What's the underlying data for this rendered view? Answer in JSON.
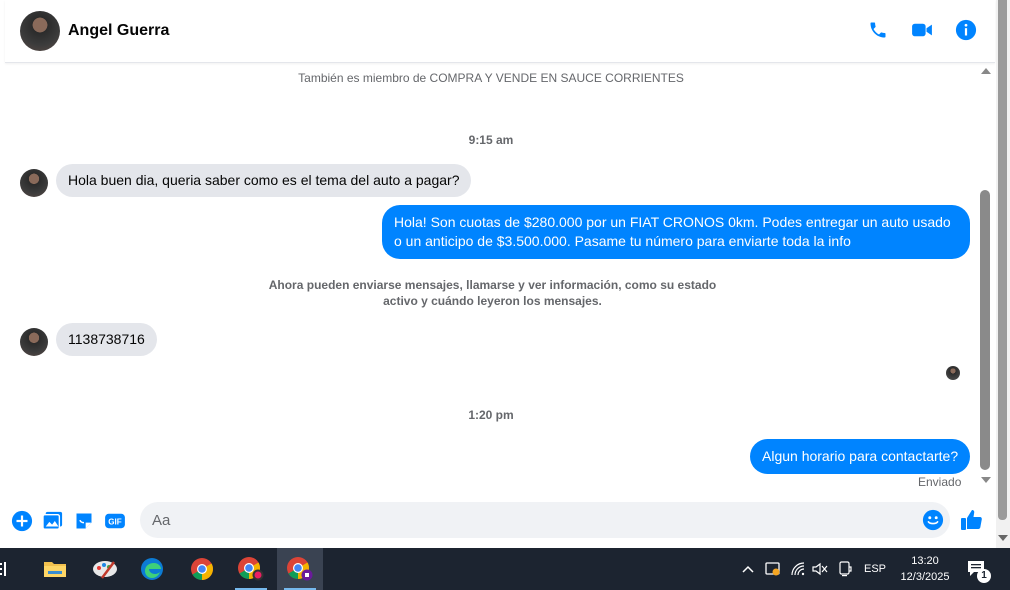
{
  "header": {
    "contact_name": "Angel Guerra"
  },
  "messages": {
    "group_info": "También es miembro de COMPRA Y VENDE EN SAUCE CORRIENTES",
    "time_1": "9:15 am",
    "incoming_1": "Hola buen dia, queria saber como es el tema del auto a pagar?",
    "outgoing_1": "Hola! Son cuotas de $280.000 por un FIAT CRONOS 0km. Podes entregar un auto usado o un anticipo de $3.500.000. Pasame tu número para enviarte toda la info",
    "notice": "Ahora pueden enviarse mensajes, llamarse y ver información, como su estado activo y cuándo leyeron los mensajes.",
    "incoming_2": "1138738716",
    "time_2": "1:20 pm",
    "outgoing_2": "Algun horario para contactarte?",
    "sent_status": "Enviado"
  },
  "composer": {
    "placeholder": "Aa"
  },
  "taskbar": {
    "language": "ESP",
    "time": "13:20",
    "date": "12/3/2025",
    "notification_count": "1"
  },
  "colors": {
    "accent": "#0084ff",
    "incoming_bubble": "#e4e6eb",
    "taskbar": "#1c2430"
  }
}
